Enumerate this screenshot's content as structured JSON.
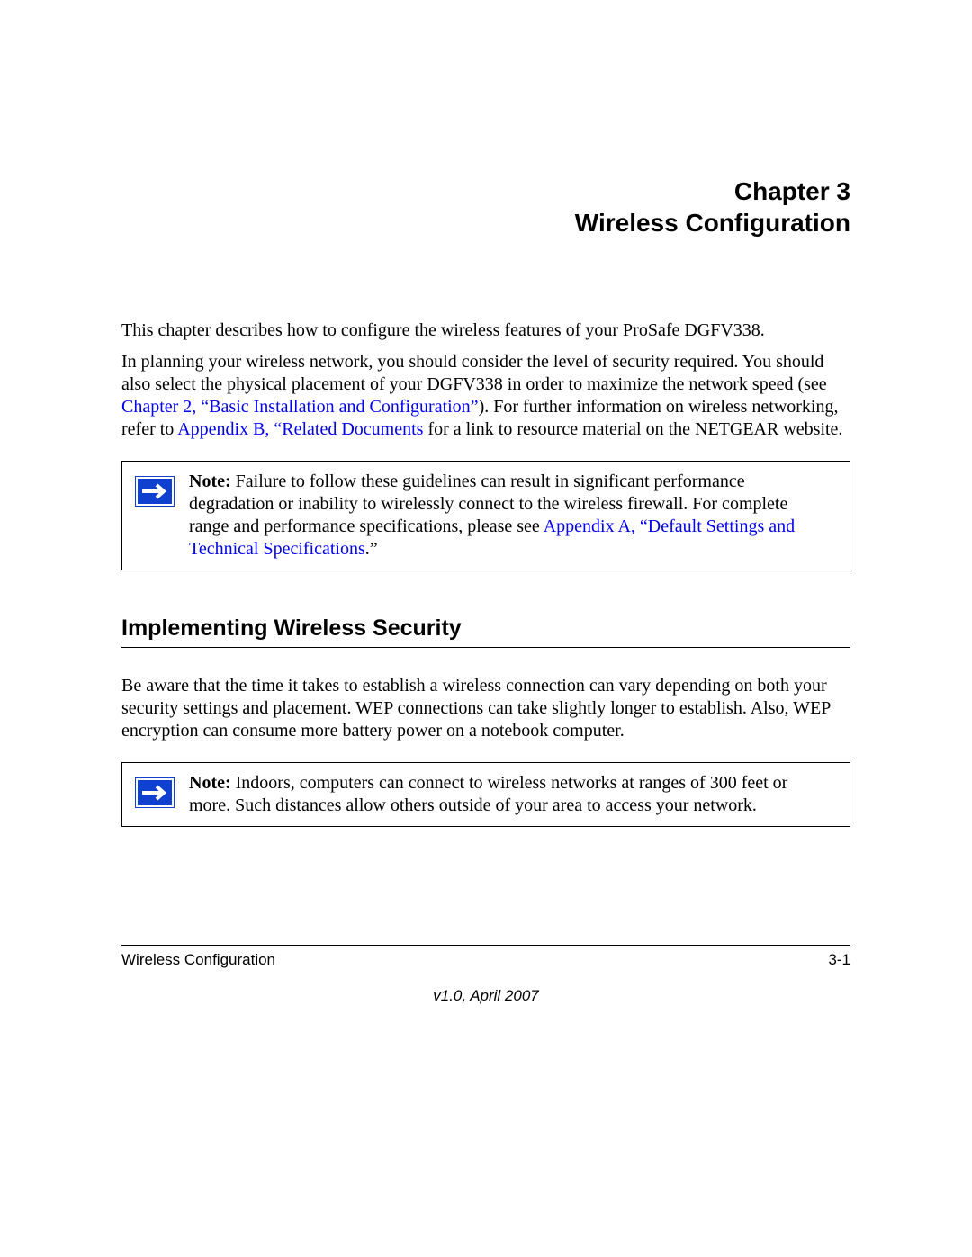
{
  "chapter": {
    "line1": "Chapter 3",
    "line2": "Wireless Configuration"
  },
  "intro": {
    "p1": "This chapter describes how to configure the wireless features of your ProSafe DGFV338.",
    "p2a": "In planning your wireless network, you should consider the level of security required. You should also select the physical placement of your DGFV338 in order to maximize the network speed (see ",
    "link1": "Chapter 2, “Basic Installation and Configuration”",
    "p2b": "). For further information on wireless networking, refer to ",
    "link2": "Appendix B, “Related Documents",
    "p2c": " for a link to resource material on the NETGEAR website."
  },
  "note1": {
    "label": "Note:",
    "text_a": " Failure to follow these guidelines can result in significant performance degradation or inability to wirelessly connect to the wireless firewall. For complete range and performance specifications, please see ",
    "link": "Appendix A, “Default Settings and Technical Specifications",
    "text_b": ".”"
  },
  "section": {
    "heading": "Implementing Wireless Security",
    "p1": "Be aware that the time it takes to establish a wireless connection can vary depending on both your security settings and placement. WEP connections can take slightly longer to establish. Also, WEP encryption can consume more battery power on a notebook computer."
  },
  "note2": {
    "label": "Note:",
    "text": " Indoors, computers can connect to wireless networks at ranges of 300 feet or more. Such distances allow others outside of your area to access your network."
  },
  "footer": {
    "left": "Wireless Configuration",
    "right": "3-1",
    "version": "v1.0, April 2007"
  }
}
